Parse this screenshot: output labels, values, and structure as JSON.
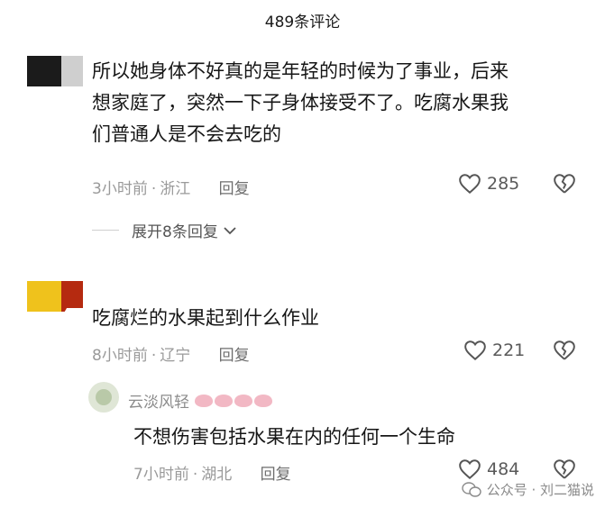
{
  "header": {
    "title": "489条评论"
  },
  "comments": [
    {
      "text_lines": [
        "所以她身体不好真的是年轻的时候为了事业，后来",
        "想家庭了，突然一下子身体接受不了。吃腐水果我",
        "们普通人是不会去吃的"
      ],
      "time": "3小时前",
      "location": "浙江",
      "reply_label": "回复",
      "likes": "285",
      "expand_label": "展开8条回复"
    },
    {
      "text_lines": [
        "吃腐烂的水果起到什么作业"
      ],
      "time": "8小时前",
      "location": "辽宁",
      "reply_label": "回复",
      "likes": "221"
    }
  ],
  "reply": {
    "username": "云淡风轻",
    "text": "不想伤害包括水果在内的任何一个生命",
    "time": "7小时前",
    "location": "湖北",
    "reply_label": "回复",
    "likes": "484"
  },
  "watermark": {
    "text": "公众号 · 刘二猫说"
  },
  "colors": {
    "meta_gray": "#9a9a9a",
    "lips_pink": "#f2b8c4",
    "icon_gray": "#555555"
  }
}
